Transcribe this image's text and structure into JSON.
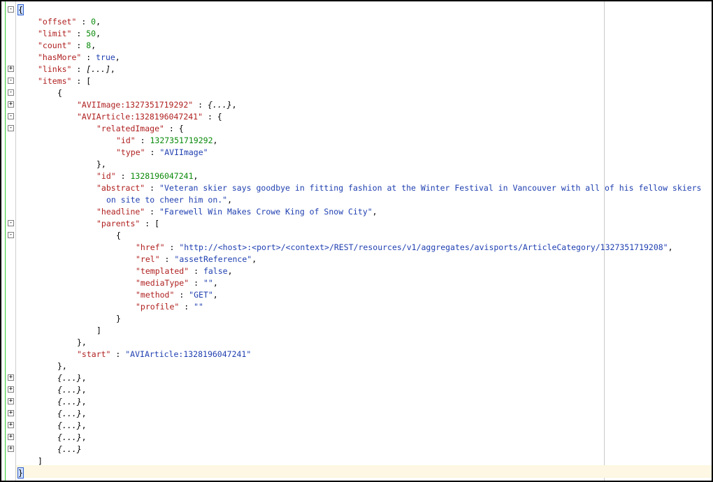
{
  "editor": {
    "lines": [
      {
        "fold": "-",
        "indent": 0,
        "tokens": [
          {
            "t": "{",
            "c": "caret-bracket"
          }
        ]
      },
      {
        "indent": 1,
        "tokens": [
          {
            "t": "\"offset\"",
            "c": "key"
          },
          {
            "t": " : ",
            "c": "pun"
          },
          {
            "t": "0",
            "c": "num"
          },
          {
            "t": ",",
            "c": "pun"
          }
        ]
      },
      {
        "indent": 1,
        "tokens": [
          {
            "t": "\"limit\"",
            "c": "key"
          },
          {
            "t": " : ",
            "c": "pun"
          },
          {
            "t": "50",
            "c": "num"
          },
          {
            "t": ",",
            "c": "pun"
          }
        ]
      },
      {
        "indent": 1,
        "tokens": [
          {
            "t": "\"count\"",
            "c": "key"
          },
          {
            "t": " : ",
            "c": "pun"
          },
          {
            "t": "8",
            "c": "num"
          },
          {
            "t": ",",
            "c": "pun"
          }
        ]
      },
      {
        "indent": 1,
        "tokens": [
          {
            "t": "\"hasMore\"",
            "c": "key"
          },
          {
            "t": " : ",
            "c": "pun"
          },
          {
            "t": "true",
            "c": "kw"
          },
          {
            "t": ",",
            "c": "pun"
          }
        ]
      },
      {
        "fold": "+",
        "indent": 1,
        "tokens": [
          {
            "t": "\"links\"",
            "c": "key"
          },
          {
            "t": " : ",
            "c": "pun"
          },
          {
            "t": "[...]",
            "c": "collapsed"
          },
          {
            "t": ",",
            "c": "pun"
          }
        ]
      },
      {
        "fold": "-",
        "indent": 1,
        "tokens": [
          {
            "t": "\"items\"",
            "c": "key"
          },
          {
            "t": " : [",
            "c": "pun"
          }
        ]
      },
      {
        "fold": "-",
        "indent": 2,
        "tokens": [
          {
            "t": "{",
            "c": "pun"
          }
        ]
      },
      {
        "fold": "+",
        "indent": 3,
        "tokens": [
          {
            "t": "\"AVIImage:1327351719292\"",
            "c": "key"
          },
          {
            "t": " : ",
            "c": "pun"
          },
          {
            "t": "{...}",
            "c": "collapsed"
          },
          {
            "t": ",",
            "c": "pun"
          }
        ]
      },
      {
        "fold": "-",
        "indent": 3,
        "tokens": [
          {
            "t": "\"AVIArticle:1328196047241\"",
            "c": "key"
          },
          {
            "t": " : {",
            "c": "pun"
          }
        ]
      },
      {
        "fold": "-",
        "indent": 4,
        "tokens": [
          {
            "t": "\"relatedImage\"",
            "c": "key"
          },
          {
            "t": " : {",
            "c": "pun"
          }
        ]
      },
      {
        "indent": 5,
        "tokens": [
          {
            "t": "\"id\"",
            "c": "key"
          },
          {
            "t": " : ",
            "c": "pun"
          },
          {
            "t": "1327351719292",
            "c": "num"
          },
          {
            "t": ",",
            "c": "pun"
          }
        ]
      },
      {
        "indent": 5,
        "tokens": [
          {
            "t": "\"type\"",
            "c": "key"
          },
          {
            "t": " : ",
            "c": "pun"
          },
          {
            "t": "\"AVIImage\"",
            "c": "str"
          }
        ]
      },
      {
        "indent": 4,
        "tokens": [
          {
            "t": "},",
            "c": "pun"
          }
        ]
      },
      {
        "indent": 4,
        "tokens": [
          {
            "t": "\"id\"",
            "c": "key"
          },
          {
            "t": " : ",
            "c": "pun"
          },
          {
            "t": "1328196047241",
            "c": "num"
          },
          {
            "t": ",",
            "c": "pun"
          }
        ]
      },
      {
        "indent": 4,
        "tokens": [
          {
            "t": "\"abstract\"",
            "c": "key"
          },
          {
            "t": " : ",
            "c": "pun"
          },
          {
            "t": "\"Veteran skier says goodbye in fitting fashion at the Winter Festival in Vancouver with all of his fellow skiers",
            "c": "str"
          }
        ]
      },
      {
        "indent": 4,
        "extra": "  ",
        "tokens": [
          {
            "t": "on site to cheer him on.\"",
            "c": "str"
          },
          {
            "t": ",",
            "c": "pun"
          }
        ]
      },
      {
        "indent": 4,
        "tokens": [
          {
            "t": "\"headline\"",
            "c": "key"
          },
          {
            "t": " : ",
            "c": "pun"
          },
          {
            "t": "\"Farewell Win Makes Crowe King of Snow City\"",
            "c": "str"
          },
          {
            "t": ",",
            "c": "pun"
          }
        ]
      },
      {
        "fold": "-",
        "indent": 4,
        "tokens": [
          {
            "t": "\"parents\"",
            "c": "key"
          },
          {
            "t": " : [",
            "c": "pun"
          }
        ]
      },
      {
        "fold": "-",
        "indent": 5,
        "tokens": [
          {
            "t": "{",
            "c": "pun"
          }
        ]
      },
      {
        "indent": 6,
        "tokens": [
          {
            "t": "\"href\"",
            "c": "key"
          },
          {
            "t": " : ",
            "c": "pun"
          },
          {
            "t": "\"http://<host>:<port>/<context>/REST/resources/v1/aggregates/avisports/ArticleCategory/1327351719208\"",
            "c": "str"
          },
          {
            "t": ",",
            "c": "pun"
          }
        ]
      },
      {
        "indent": 6,
        "tokens": [
          {
            "t": "\"rel\"",
            "c": "key"
          },
          {
            "t": " : ",
            "c": "pun"
          },
          {
            "t": "\"assetReference\"",
            "c": "str"
          },
          {
            "t": ",",
            "c": "pun"
          }
        ]
      },
      {
        "indent": 6,
        "tokens": [
          {
            "t": "\"templated\"",
            "c": "key"
          },
          {
            "t": " : ",
            "c": "pun"
          },
          {
            "t": "false",
            "c": "kw"
          },
          {
            "t": ",",
            "c": "pun"
          }
        ]
      },
      {
        "indent": 6,
        "tokens": [
          {
            "t": "\"mediaType\"",
            "c": "key"
          },
          {
            "t": " : ",
            "c": "pun"
          },
          {
            "t": "\"\"",
            "c": "str"
          },
          {
            "t": ",",
            "c": "pun"
          }
        ]
      },
      {
        "indent": 6,
        "tokens": [
          {
            "t": "\"method\"",
            "c": "key"
          },
          {
            "t": " : ",
            "c": "pun"
          },
          {
            "t": "\"GET\"",
            "c": "str"
          },
          {
            "t": ",",
            "c": "pun"
          }
        ]
      },
      {
        "indent": 6,
        "tokens": [
          {
            "t": "\"profile\"",
            "c": "key"
          },
          {
            "t": " : ",
            "c": "pun"
          },
          {
            "t": "\"\"",
            "c": "str"
          }
        ]
      },
      {
        "indent": 5,
        "tokens": [
          {
            "t": "}",
            "c": "pun"
          }
        ]
      },
      {
        "indent": 4,
        "tokens": [
          {
            "t": "]",
            "c": "pun"
          }
        ]
      },
      {
        "indent": 3,
        "tokens": [
          {
            "t": "},",
            "c": "pun"
          }
        ]
      },
      {
        "indent": 3,
        "tokens": [
          {
            "t": "\"start\"",
            "c": "key"
          },
          {
            "t": " : ",
            "c": "pun"
          },
          {
            "t": "\"AVIArticle:1328196047241\"",
            "c": "str"
          }
        ]
      },
      {
        "indent": 2,
        "tokens": [
          {
            "t": "},",
            "c": "pun"
          }
        ]
      },
      {
        "fold": "+",
        "indent": 2,
        "tokens": [
          {
            "t": "{...}",
            "c": "collapsed"
          },
          {
            "t": ",",
            "c": "pun"
          }
        ]
      },
      {
        "fold": "+",
        "indent": 2,
        "tokens": [
          {
            "t": "{...}",
            "c": "collapsed"
          },
          {
            "t": ",",
            "c": "pun"
          }
        ]
      },
      {
        "fold": "+",
        "indent": 2,
        "tokens": [
          {
            "t": "{...}",
            "c": "collapsed"
          },
          {
            "t": ",",
            "c": "pun"
          }
        ]
      },
      {
        "fold": "+",
        "indent": 2,
        "tokens": [
          {
            "t": "{...}",
            "c": "collapsed"
          },
          {
            "t": ",",
            "c": "pun"
          }
        ]
      },
      {
        "fold": "+",
        "indent": 2,
        "tokens": [
          {
            "t": "{...}",
            "c": "collapsed"
          },
          {
            "t": ",",
            "c": "pun"
          }
        ]
      },
      {
        "fold": "+",
        "indent": 2,
        "tokens": [
          {
            "t": "{...}",
            "c": "collapsed"
          },
          {
            "t": ",",
            "c": "pun"
          }
        ]
      },
      {
        "fold": "+",
        "indent": 2,
        "tokens": [
          {
            "t": "{...}",
            "c": "collapsed"
          }
        ]
      },
      {
        "indent": 1,
        "tokens": [
          {
            "t": "]",
            "c": "pun"
          }
        ]
      },
      {
        "indent": 0,
        "tokens": [
          {
            "t": "}",
            "c": "caret-bracket"
          }
        ]
      }
    ]
  },
  "colors": {
    "key": "#b02020",
    "string": "#1f3fb0",
    "number": "#0a8a0a",
    "keyword": "#1f3fb0",
    "current_line": "#fdf7e3",
    "gutter_change_marker": "#33cc33"
  }
}
